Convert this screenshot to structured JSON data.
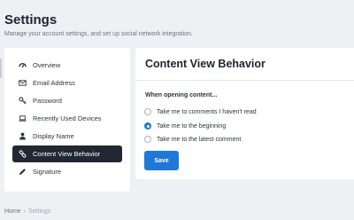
{
  "header": {
    "title": "Settings",
    "subtitle": "Manage your account settings, and set up social network integration."
  },
  "sidebar": {
    "items": [
      {
        "label": "Overview",
        "icon": "gauge-icon",
        "active": false
      },
      {
        "label": "Email Address",
        "icon": "envelope-icon",
        "active": false
      },
      {
        "label": "Password",
        "icon": "key-icon",
        "active": false
      },
      {
        "label": "Recently Used Devices",
        "icon": "laptop-icon",
        "active": false
      },
      {
        "label": "Display Name",
        "icon": "user-icon",
        "active": false
      },
      {
        "label": "Content View Behavior",
        "icon": "link-icon",
        "active": true
      },
      {
        "label": "Signature",
        "icon": "pen-icon",
        "active": false
      }
    ]
  },
  "panel": {
    "title": "Content View Behavior",
    "section_label": "When opening content...",
    "options": [
      {
        "label": "Take me to comments I haven't read",
        "checked": false
      },
      {
        "label": "Take me to the beginning",
        "checked": true
      },
      {
        "label": "Take me to the latest comment",
        "checked": false
      }
    ],
    "save_label": "Save"
  },
  "breadcrumb": {
    "home": "Home",
    "separator": "›",
    "current": "Settings"
  },
  "colors": {
    "accent": "#1f78d6",
    "active_nav_bg": "#212833",
    "page_bg": "#eef0f4"
  }
}
